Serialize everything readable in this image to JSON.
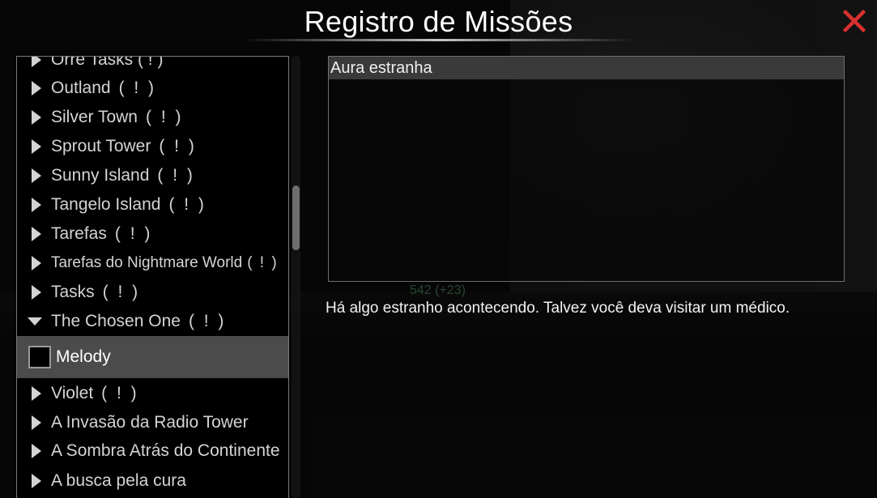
{
  "window": {
    "title": "Registro de Missões",
    "close_icon": "close-x-icon",
    "accent_color": "#d93030"
  },
  "quest_list": {
    "items": [
      {
        "label": "Outland",
        "badge": "( ! )",
        "state": "collapsed"
      },
      {
        "label": "Silver Town",
        "badge": "( ! )",
        "state": "collapsed"
      },
      {
        "label": "Sprout Tower",
        "badge": "( ! )",
        "state": "collapsed"
      },
      {
        "label": "Sunny Island",
        "badge": "( ! )",
        "state": "collapsed"
      },
      {
        "label": "Tangelo Island",
        "badge": "( ! )",
        "state": "collapsed"
      },
      {
        "label": "Tarefas",
        "badge": "( ! )",
        "state": "collapsed"
      },
      {
        "label": "Tarefas do Nightmare World",
        "badge": "( ! )",
        "state": "collapsed"
      },
      {
        "label": "Tasks",
        "badge": "( ! )",
        "state": "collapsed"
      },
      {
        "label": "The Chosen One",
        "badge": "( ! )",
        "state": "expanded"
      },
      {
        "label": "Melody",
        "state": "selected-child"
      },
      {
        "label": "Violet",
        "badge": "( ! )",
        "state": "collapsed"
      },
      {
        "label": "A Invasão da Radio Tower",
        "state": "collapsed"
      },
      {
        "label": "A Sombra Atrás do Continente",
        "state": "collapsed"
      },
      {
        "label": "A busca pela cura",
        "state": "collapsed"
      }
    ],
    "partial_top_label": "Orre Tasks ( ! )"
  },
  "detail": {
    "objective": "Aura estranha",
    "description": "Há algo estranho acontecendo. Talvez você deva visitar um médico."
  },
  "hud": {
    "value": "542",
    "extra": "(+23)"
  }
}
